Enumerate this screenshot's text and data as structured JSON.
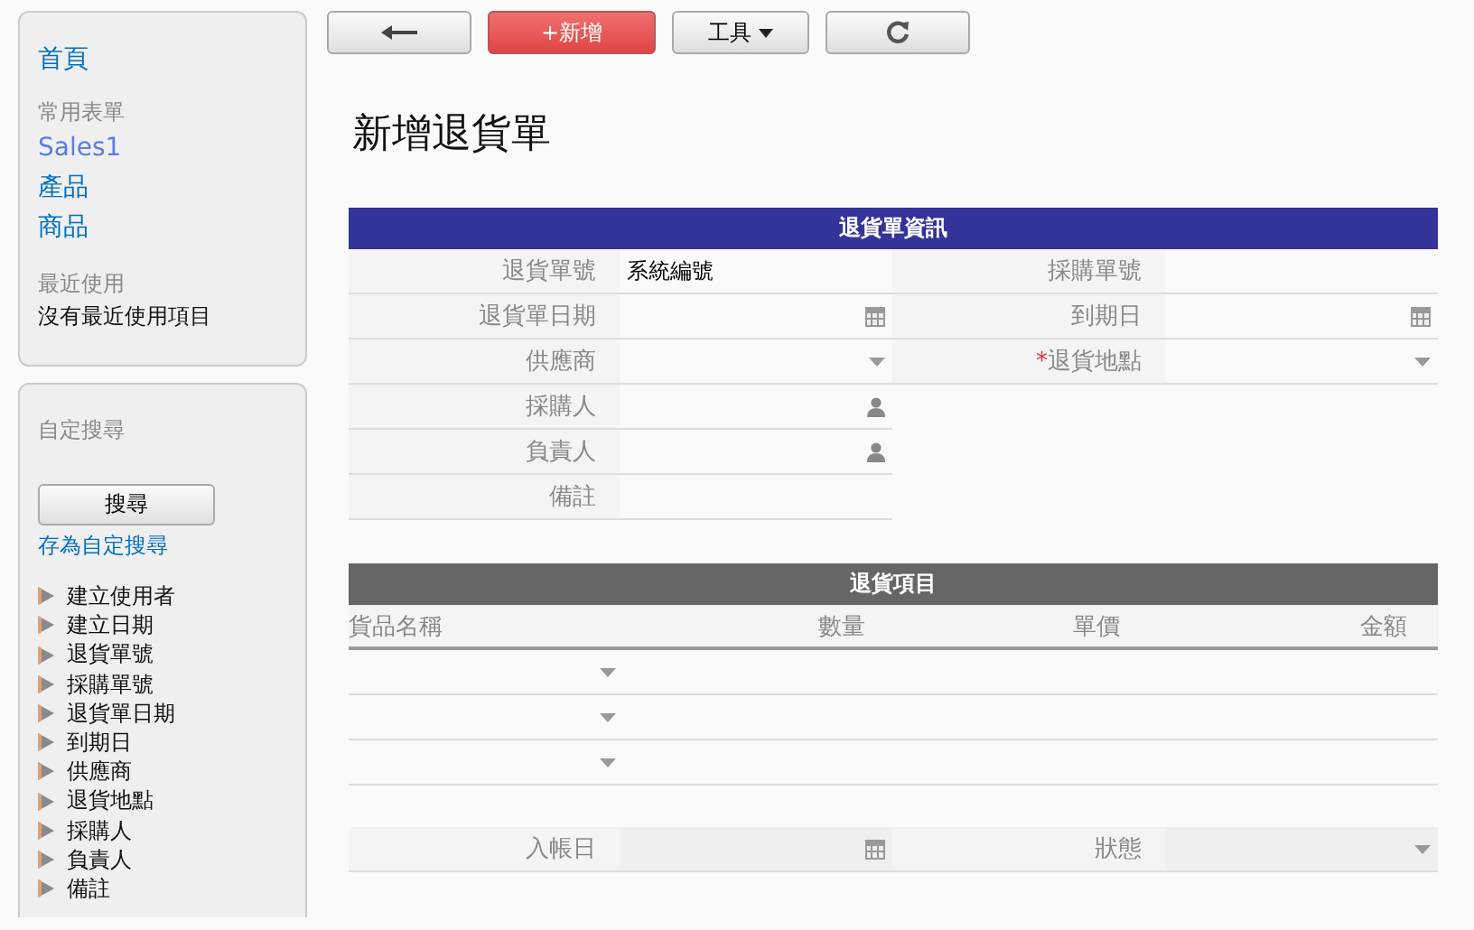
{
  "sidebar": {
    "home_link": "首頁",
    "favorites": {
      "heading": "常用表單",
      "items": [
        {
          "label": "Sales1",
          "visited": true
        },
        {
          "label": "產品",
          "visited": false
        },
        {
          "label": "商品",
          "visited": false
        }
      ]
    },
    "recent": {
      "heading": "最近使用",
      "empty_text": "沒有最近使用項目"
    }
  },
  "search_panel": {
    "heading": "自定搜尋",
    "search_button": "搜尋",
    "save_link": "存為自定搜尋",
    "fields": [
      "建立使用者",
      "建立日期",
      "退貨單號",
      "採購單號",
      "退貨單日期",
      "到期日",
      "供應商",
      "退貨地點",
      "採購人",
      "負責人",
      "備註"
    ]
  },
  "toolbar": {
    "new_button": "+新增",
    "tools_button": "工具"
  },
  "page_title": "新增退貨單",
  "info_section": {
    "title": "退貨單資訊",
    "required_marker": "*",
    "left_fields": [
      {
        "label": "退貨單號",
        "kind": "text",
        "value": "系統編號",
        "required": false
      },
      {
        "label": "退貨單日期",
        "kind": "date",
        "required": false
      },
      {
        "label": "供應商",
        "kind": "select",
        "required": false
      },
      {
        "label": "採購人",
        "kind": "person",
        "required": false
      },
      {
        "label": "負責人",
        "kind": "person",
        "required": false
      },
      {
        "label": "備註",
        "kind": "text",
        "required": false
      }
    ],
    "right_fields": [
      {
        "label": "採購單號",
        "kind": "text",
        "required": false
      },
      {
        "label": "到期日",
        "kind": "date",
        "required": false
      },
      {
        "label": "退貨地點",
        "kind": "select",
        "required": true
      }
    ]
  },
  "items_section": {
    "title": "退貨項目",
    "columns": [
      "貨品名稱",
      "數量",
      "單價",
      "金額"
    ],
    "rows": [
      {
        "kind": "select"
      },
      {
        "kind": "select"
      },
      {
        "kind": "select"
      }
    ],
    "footer_fields": [
      {
        "label": "入帳日",
        "kind": "date",
        "required": false
      },
      {
        "label": "狀態",
        "kind": "select",
        "required": false
      }
    ]
  }
}
